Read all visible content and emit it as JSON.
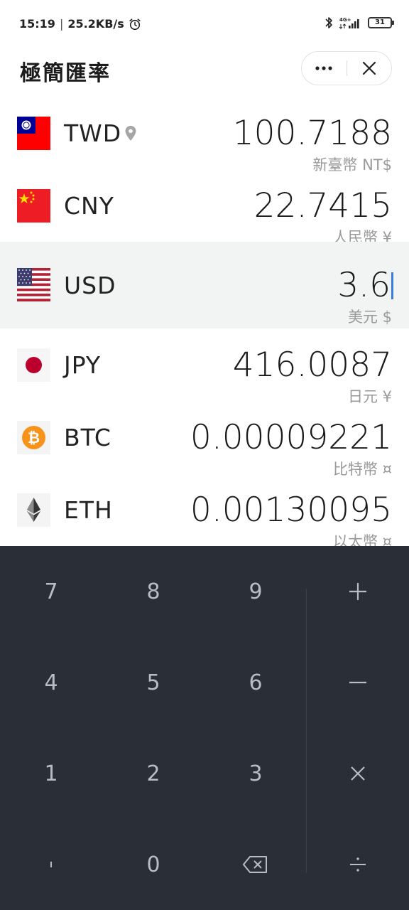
{
  "status": {
    "time": "15:19",
    "net_speed": "25.2KB/s",
    "network": "4G+",
    "battery": "31"
  },
  "header": {
    "title": "極簡匯率"
  },
  "currencies": [
    {
      "code": "TWD",
      "amount": "100.7188",
      "name": "新臺幣 NT$",
      "located": true
    },
    {
      "code": "CNY",
      "amount": "22.7415",
      "name": "人民幣 ¥"
    },
    {
      "code": "USD",
      "amount": "3.6",
      "name": "美元 $",
      "active": true
    },
    {
      "code": "JPY",
      "amount": "416.0087",
      "name": "日元 ¥"
    },
    {
      "code": "BTC",
      "amount": "0.00009221",
      "name": "比特幣 ¤"
    },
    {
      "code": "ETH",
      "amount": "0.00130095",
      "name": "以太幣 ¤"
    }
  ],
  "keypad": {
    "k7": "7",
    "k8": "8",
    "k9": "9",
    "plus": "+",
    "k4": "4",
    "k5": "5",
    "k6": "6",
    "minus": "—",
    "k1": "1",
    "k2": "2",
    "k3": "3",
    "times": "×",
    "dot": "ˌ",
    "k0": "0",
    "divide": "÷"
  },
  "colors": {
    "keypad_bg": "#2a2e36",
    "key_text": "#b8bcc4",
    "cursor": "#3b7ddd",
    "active_row": "#f2f3f3"
  }
}
